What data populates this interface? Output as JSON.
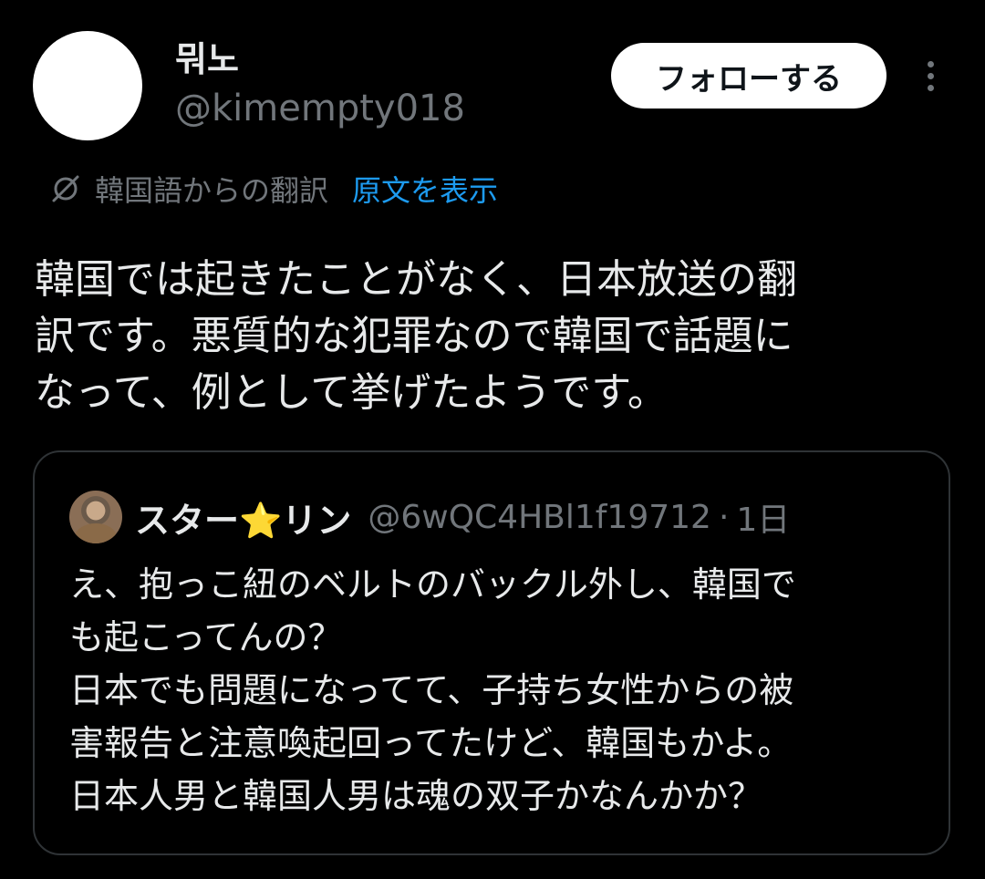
{
  "author": {
    "display_name": "뭐노",
    "handle": "@kimempty018"
  },
  "actions": {
    "follow_label": "フォローする",
    "more_icon": "more-vertical-icon"
  },
  "translation": {
    "icon": "globe-translate-icon",
    "label": "韓国語からの翻訳",
    "show_original": "原文を表示"
  },
  "tweet": {
    "text": "韓国では起きたことがなく、日本放送の翻\n訳です。悪質的な犯罪なので韓国で話題に\nなって、例として挙げたようです。"
  },
  "quote": {
    "name_prefix": "スター",
    "name_star": "⭐",
    "name_suffix": "リン",
    "handle": "@6wQC4HBl1f19712",
    "separator": "·",
    "time": "1日",
    "text": "え、抱っこ紐のベルトのバックル外し、韓国で\nも起こってんの？\n日本でも問題になってて、子持ち女性からの被\n害報告と注意喚起回ってたけど、韓国もかよ。\n日本人男と韓国人男は魂の双子かなんかか？"
  },
  "colors": {
    "background": "#000000",
    "text_primary": "#e7e9ea",
    "text_secondary": "#71767b",
    "link": "#1d9bf0",
    "border": "#2f3336",
    "follow_bg": "#ffffff"
  }
}
